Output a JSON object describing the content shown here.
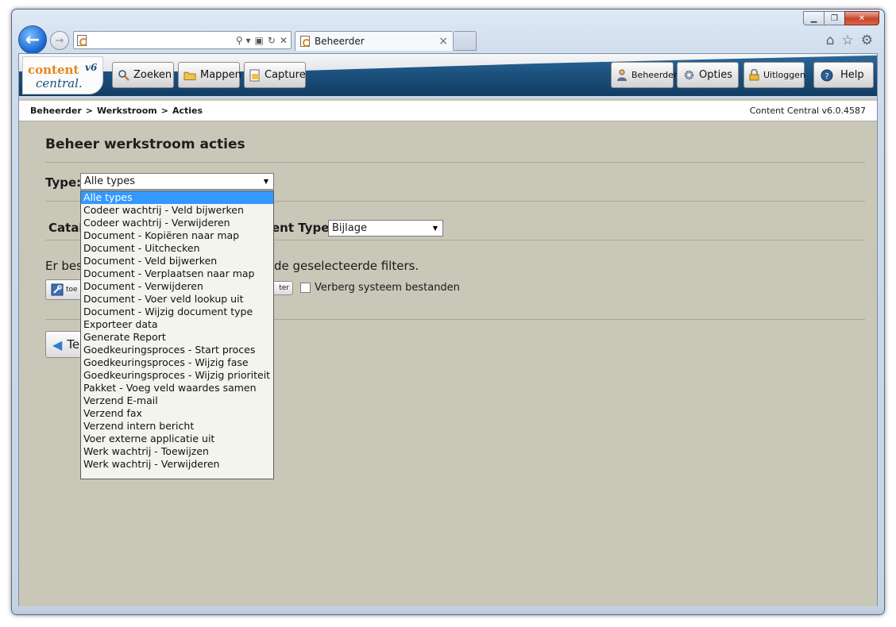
{
  "browser": {
    "address_value": "",
    "tab_title": "Beheerder",
    "tab_close": "×",
    "addr_icons": [
      "⚲ ▾",
      "▣",
      "↻",
      "✕"
    ],
    "tools_icons": [
      "⌂",
      "☆",
      "⚙"
    ],
    "back_arrow": "←",
    "fwd_arrow": "→",
    "caption": {
      "min": "▁",
      "max": "❐",
      "close": "✕"
    }
  },
  "app": {
    "logo": {
      "line1": "content",
      "line2": "central.",
      "version": "v6"
    },
    "nav_buttons": [
      {
        "label": "Zoeken",
        "icon": "search-icon"
      },
      {
        "label": "Mappen",
        "icon": "folder-icon"
      },
      {
        "label": "Capture",
        "icon": "capture-icon"
      }
    ],
    "right_buttons": [
      {
        "label": "Beheerder",
        "icon": "user-icon"
      },
      {
        "label": "Opties",
        "icon": "gear-icon"
      },
      {
        "label": "Uitloggen",
        "icon": "lock-icon"
      },
      {
        "label": "Help",
        "icon": "help-icon"
      }
    ]
  },
  "breadcrumb": {
    "items": [
      "Beheerder",
      "Werkstroom",
      "Acties"
    ],
    "separator": ">",
    "version": "Content Central v6.0.4587"
  },
  "page": {
    "title": "Beheer werkstroom acties",
    "type_label": "Type:",
    "type_selected": "Alle types",
    "catalog_label": "Catal",
    "content_type_label": "ent Type:",
    "content_type_selected": "Bijlage",
    "info_start": "Er bes",
    "info_end": "de geselecteerde filters.",
    "small_button_label": "toe",
    "ter_button_label": "ter",
    "hide_system_label": "Verberg systeem bestanden",
    "back_button_label": "Te"
  },
  "dropdown": {
    "selected_index": 0,
    "options": [
      "Alle types",
      "Codeer wachtrij - Veld bijwerken",
      "Codeer wachtrij - Verwijderen",
      "Document - Kopiëren naar map",
      "Document - Uitchecken",
      "Document - Veld bijwerken",
      "Document - Verplaatsen naar map",
      "Document - Verwijderen",
      "Document - Voer veld lookup uit",
      "Document - Wijzig document type",
      "Exporteer data",
      "Generate Report",
      "Goedkeuringsproces - Start proces",
      "Goedkeuringsproces - Wijzig fase",
      "Goedkeuringsproces - Wijzig prioriteit",
      "Pakket - Voeg veld waardes samen",
      "Verzend E-mail",
      "Verzend fax",
      "Verzend intern bericht",
      "Voer externe applicatie uit",
      "Werk wachtrij - Toewijzen",
      "Werk wachtrij - Verwijderen"
    ]
  },
  "colors": {
    "content_bg": "#c9c7b8",
    "header_blue": "#1c527e",
    "selection_blue": "#3399ff",
    "logo_orange": "#e3861c"
  }
}
